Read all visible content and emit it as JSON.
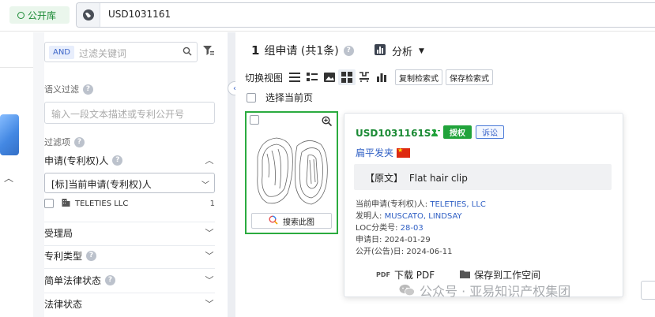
{
  "topbar": {
    "public_btn": "公开库",
    "search_value": "USD1031161"
  },
  "filter": {
    "and_tag": "AND",
    "keyword_placeholder": "过滤关键词",
    "semantic_label": "语义过滤",
    "semantic_placeholder": "输入一段文本描述或专利公开号",
    "filter_items_label": "过滤项",
    "applicant_group": "申请(专利权)人",
    "applicant_select": "[标]当前申请(专利权)人",
    "applicant_value": "TELETIES LLC",
    "applicant_count": "1",
    "groups": [
      "受理局",
      "专利类型",
      "简单法律状态",
      "法律状态"
    ]
  },
  "main": {
    "result_count_bold": "1",
    "result_title": "组申请 (共1条)",
    "analysis": "分析",
    "switch_view": "切换视图",
    "copy_query": "复制检索式",
    "save_query": "保存检索式",
    "select_page": "选择当前页",
    "search_image": "搜索此图"
  },
  "popup": {
    "pn": "USD1031161S1",
    "granted": "授权",
    "litigation": "诉讼",
    "title": "扁平发夹",
    "original_tag": "【原文】",
    "original_text": "Flat hair clip",
    "applicant_label": "当前申请(专利权)人:",
    "applicant": "TELETIES, LLC",
    "inventor_label": "发明人:",
    "inventor": "MUSCATO, LINDSAY",
    "loc_label": "LOC分类号:",
    "loc": "28-03",
    "app_date_label": "申请日:",
    "app_date": "2024-01-29",
    "pub_date_label": "公开(公告)日:",
    "pub_date": "2024-06-11",
    "download_pdf": "下载 PDF",
    "save_workspace": "保存到工作空间"
  },
  "watermark": "公众号 · 亚易知识产权集团",
  "colors": {
    "green": "#21a33b",
    "blue_link": "#2f5fc4",
    "card_border": "#2bab3f"
  }
}
